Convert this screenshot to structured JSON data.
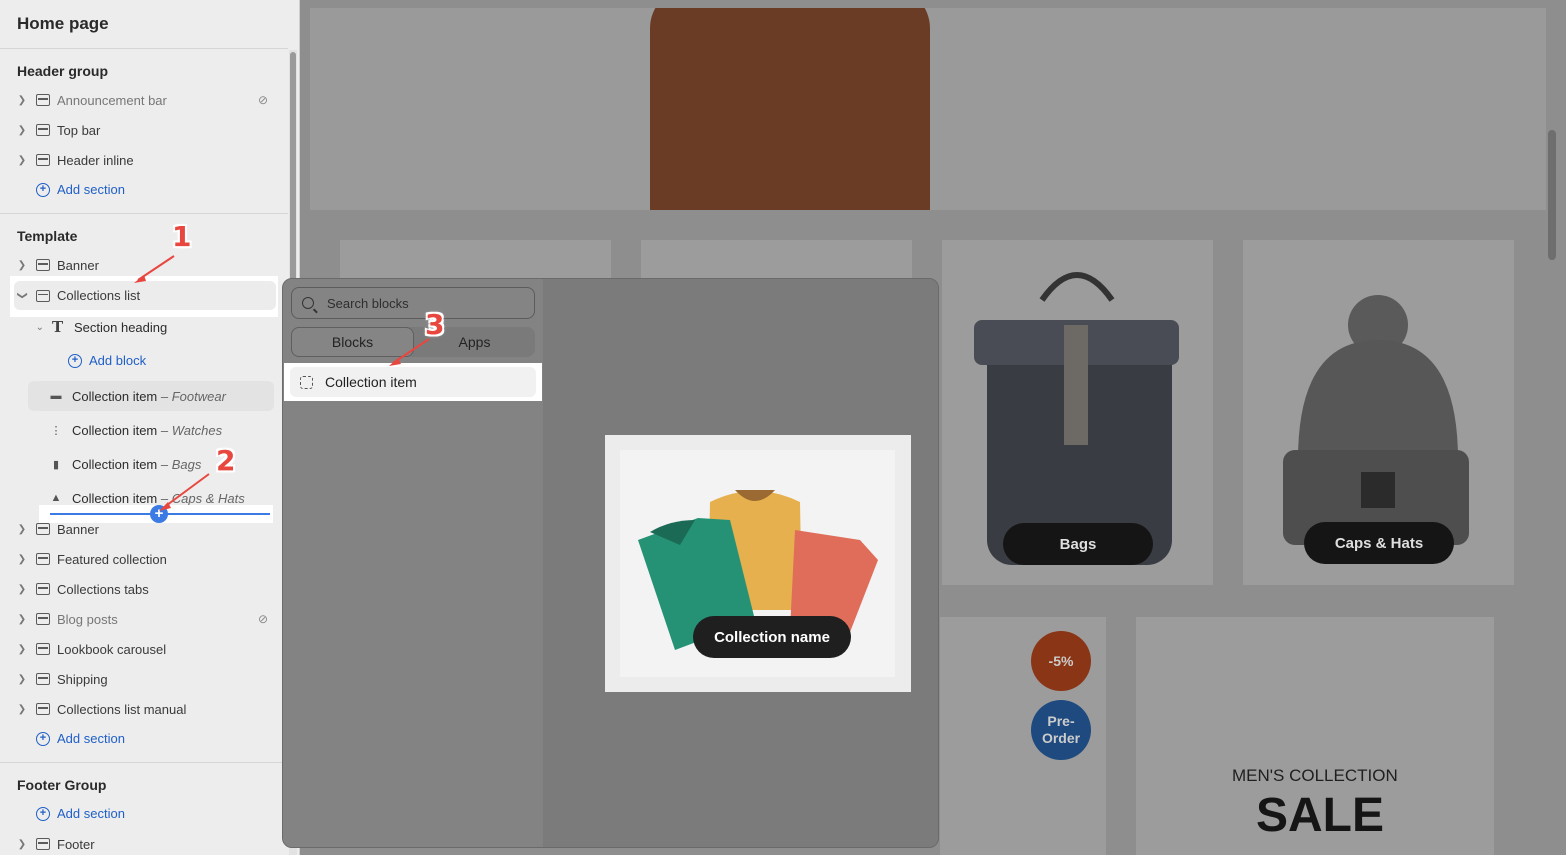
{
  "sidebar": {
    "page_title": "Home page",
    "header_group": {
      "title": "Header group",
      "items": [
        {
          "label": "Announcement bar",
          "hidden": true
        },
        {
          "label": "Top bar"
        },
        {
          "label": "Header inline"
        }
      ],
      "add_label": "Add section"
    },
    "template": {
      "title": "Template",
      "items": [
        {
          "label": "Banner"
        },
        {
          "label": "Collections list"
        }
      ],
      "section_heading": "Section heading",
      "add_block_label": "Add block",
      "blocks": [
        {
          "label": "Collection item",
          "detail": "– Footwear"
        },
        {
          "label": "Collection item",
          "detail": "– Watches"
        },
        {
          "label": "Collection item",
          "detail": "– Bags"
        },
        {
          "label": "Collection item",
          "detail": "– Caps & Hats"
        }
      ],
      "more_items": [
        {
          "label": "Banner"
        },
        {
          "label": "Featured collection"
        },
        {
          "label": "Collections tabs"
        },
        {
          "label": "Blog posts",
          "hidden": true
        },
        {
          "label": "Lookbook carousel"
        },
        {
          "label": "Shipping"
        },
        {
          "label": "Collections list manual"
        }
      ],
      "add_label": "Add section"
    },
    "footer_group": {
      "title": "Footer Group",
      "add_label": "Add section",
      "items": [
        {
          "label": "Footer"
        }
      ]
    }
  },
  "picker": {
    "search_placeholder": "Search blocks",
    "tabs": [
      "Blocks",
      "Apps"
    ],
    "active_tab": "Blocks",
    "item": "Collection item",
    "preview_pill": "Collection name"
  },
  "preview": {
    "cards": [
      "Bags",
      "Caps & Hats"
    ],
    "badge_discount": "-5%",
    "badge_preorder": "Pre-\nOrder",
    "mens_title": "MEN'S COLLECTION",
    "sale": "SALE"
  },
  "callouts": [
    "1",
    "2",
    "3"
  ],
  "colors": {
    "accent": "#e8473f",
    "link": "#1f5fc8",
    "insert": "#3b7be3"
  }
}
